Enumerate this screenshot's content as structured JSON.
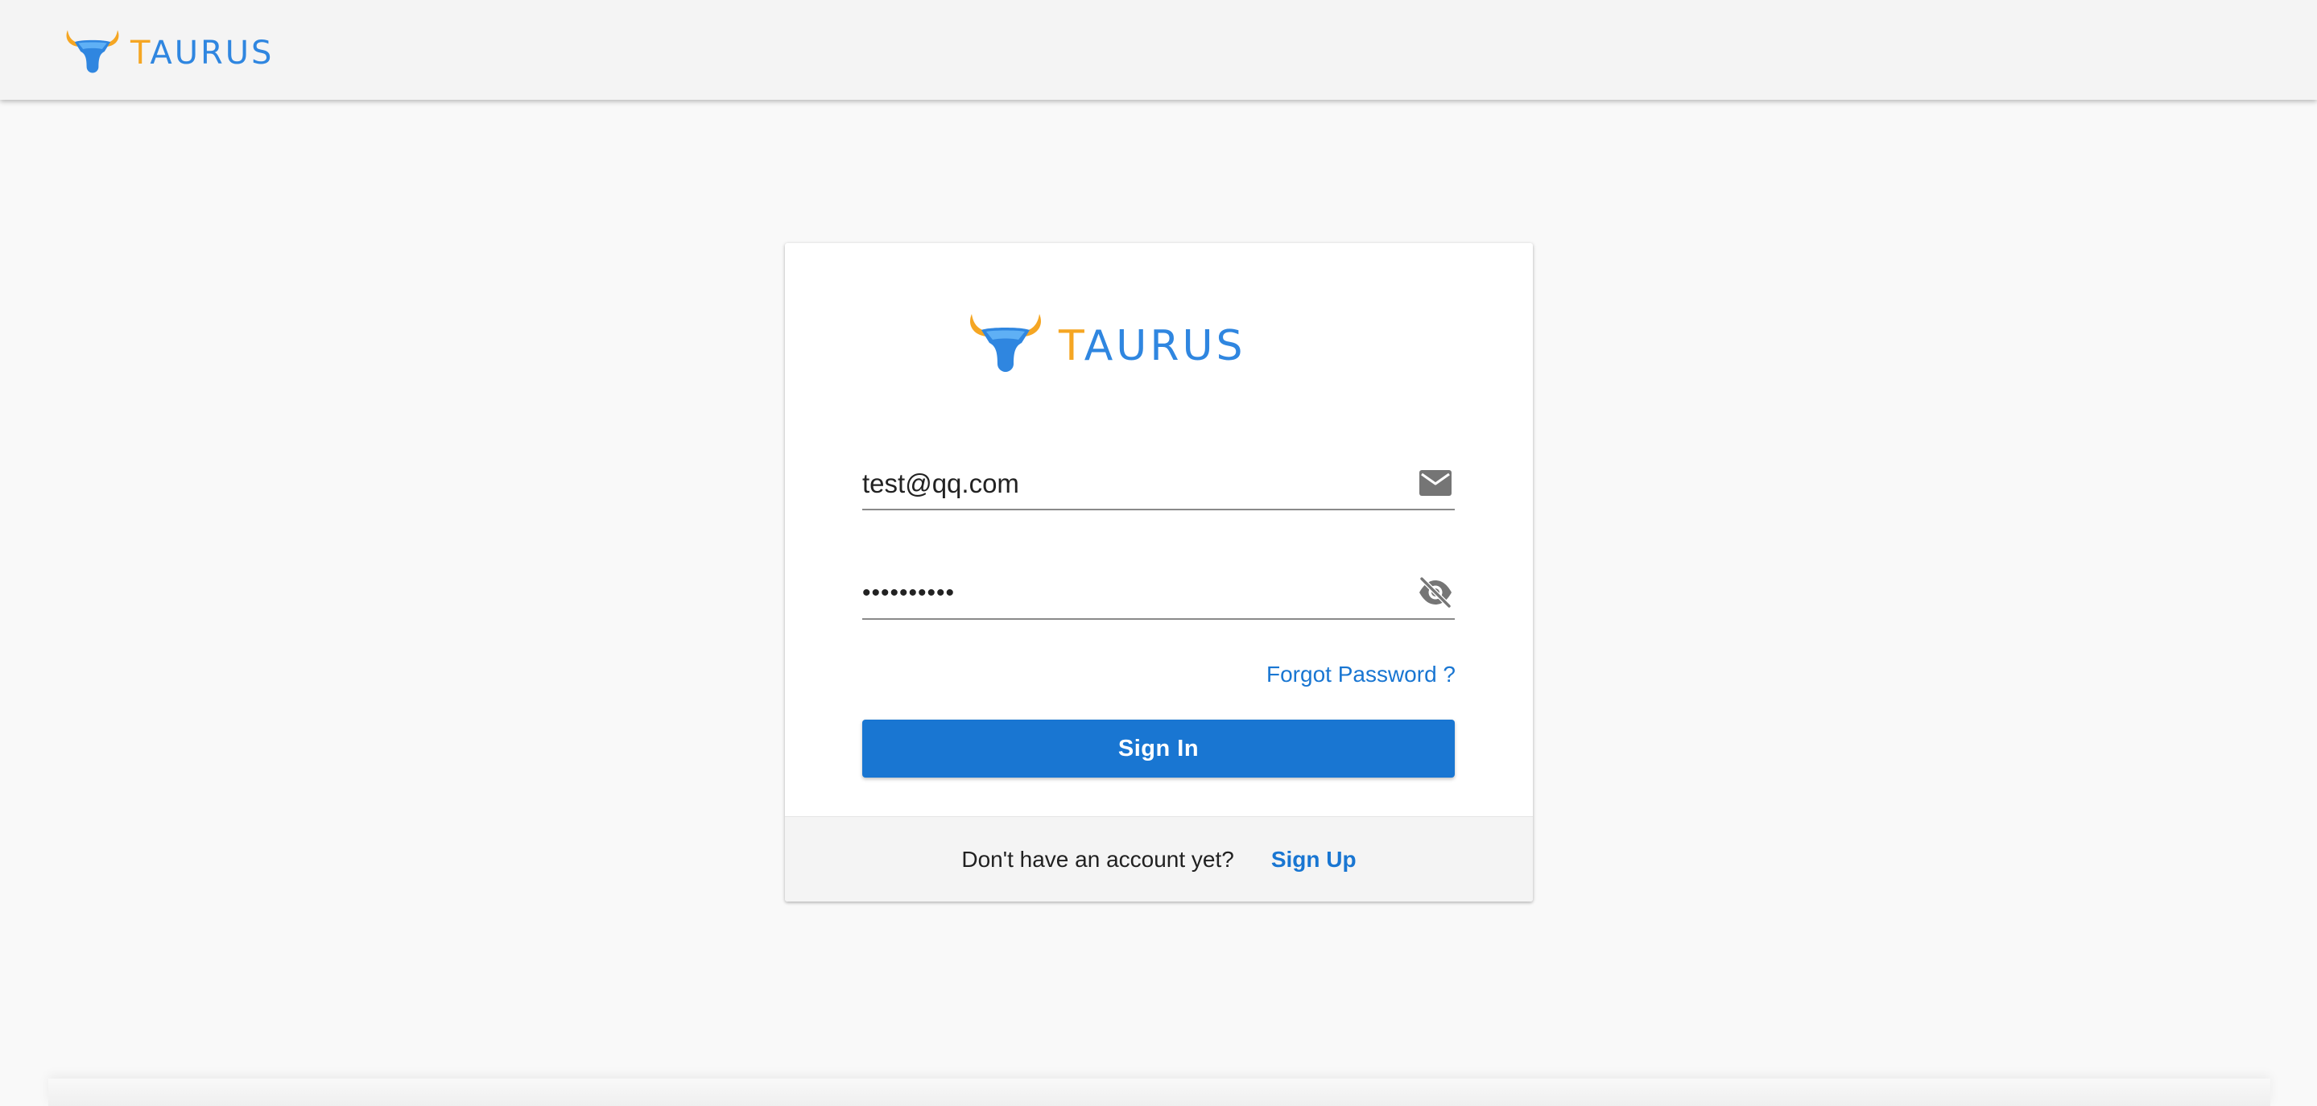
{
  "brand": {
    "name_first_letter": "T",
    "name_rest": "AURUS",
    "colors": {
      "orange": "#f5a623",
      "blue": "#2f86e0"
    }
  },
  "login": {
    "email_value": "test@qq.com",
    "password_value": "••••••••••",
    "forgot_label": "Forgot Password ?",
    "signin_label": "Sign In",
    "footer_question": "Don't have an account yet?",
    "signup_label": "Sign Up",
    "accent_color": "#1976d2"
  },
  "icons": {
    "email": "mail-icon",
    "password_toggle": "eye-off-icon"
  }
}
